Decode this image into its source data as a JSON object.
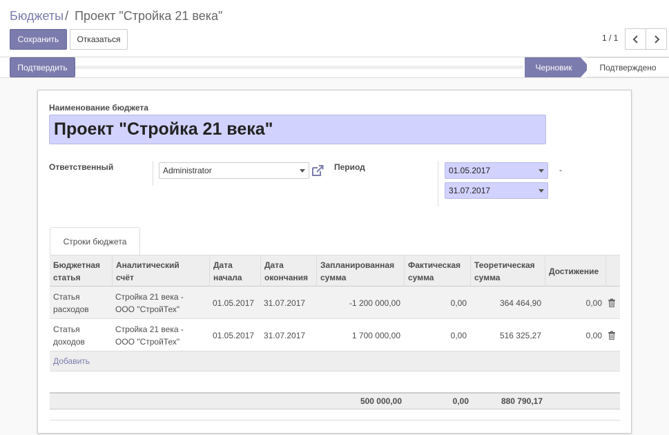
{
  "breadcrumb": {
    "parent": "Бюджеты",
    "separator": "/",
    "current": "Проект \"Стройка 21 века\""
  },
  "toolbar": {
    "save_label": "Сохранить",
    "discard_label": "Отказаться"
  },
  "pager": {
    "value": "1 / 1",
    "prev_icon": "chevron-left-icon",
    "next_icon": "chevron-right-icon"
  },
  "statusbar": {
    "confirm_label": "Подтвердить",
    "stages": [
      "Черновик",
      "Подтверждено"
    ],
    "active_stage": "Черновик"
  },
  "form": {
    "name_label": "Наименование бюджета",
    "name_value": "Проект \"Стройка 21 века\"",
    "responsible_label": "Ответственный",
    "responsible_value": "Administrator",
    "period_label": "Период",
    "date_from": "01.05.2017",
    "date_to": "31.07.2017",
    "period_dash": "-"
  },
  "tabs": [
    {
      "label": "Строки бюджета"
    }
  ],
  "table": {
    "columns": [
      {
        "line1": "Бюджетная",
        "line2": "статья"
      },
      {
        "line1": "Аналитический",
        "line2": "счёт"
      },
      {
        "line1": "Дата",
        "line2": "начала"
      },
      {
        "line1": "Дата",
        "line2": "окончания"
      },
      {
        "line1": "Запланированная",
        "line2": "сумма"
      },
      {
        "line1": "Фактическая",
        "line2": "сумма"
      },
      {
        "line1": "Теоретическая",
        "line2": "сумма"
      },
      {
        "line1": "Достижение",
        "line2": ""
      }
    ],
    "rows": [
      {
        "item_1": "Статья",
        "item_2": "расходов",
        "account_1": "Стройка 21 века -",
        "account_2": "ООО \"СтройТех\"",
        "date_from": "01.05.2017",
        "date_to": "31.07.2017",
        "planned": "-1 200 000,00",
        "actual": "0,00",
        "theoretical": "364 464,90",
        "achievement": "0,00"
      },
      {
        "item_1": "Статья",
        "item_2": "доходов",
        "account_1": "Стройка 21 века -",
        "account_2": "ООО \"СтройТех\"",
        "date_from": "01.05.2017",
        "date_to": "31.07.2017",
        "planned": "1 700 000,00",
        "actual": "0,00",
        "theoretical": "516 325,27",
        "achievement": "0,00"
      }
    ],
    "add_label": "Добавить",
    "totals": {
      "planned": "500 000,00",
      "actual": "0,00",
      "theoretical": "880 790,17"
    }
  },
  "colors": {
    "accent": "#7c7bad",
    "required_field": "#d2d2ff"
  }
}
